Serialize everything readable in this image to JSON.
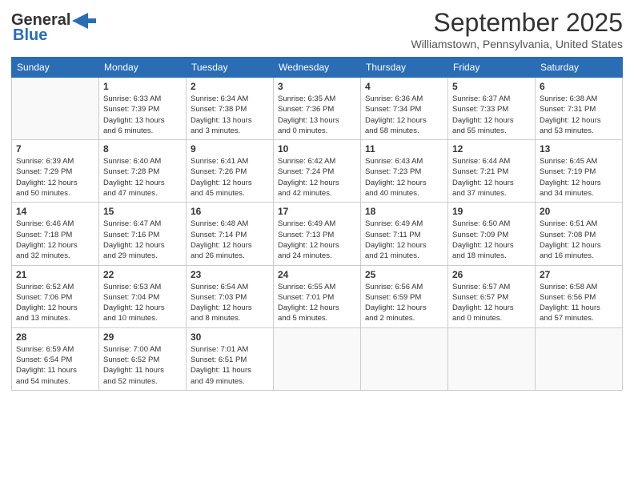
{
  "logo": {
    "line1": "General",
    "line2": "Blue",
    "arrow_color": "#2a6db5"
  },
  "title": "September 2025",
  "location": "Williamstown, Pennsylvania, United States",
  "days_of_week": [
    "Sunday",
    "Monday",
    "Tuesday",
    "Wednesday",
    "Thursday",
    "Friday",
    "Saturday"
  ],
  "weeks": [
    [
      {
        "day": "",
        "info": ""
      },
      {
        "day": "1",
        "info": "Sunrise: 6:33 AM\nSunset: 7:39 PM\nDaylight: 13 hours\nand 6 minutes."
      },
      {
        "day": "2",
        "info": "Sunrise: 6:34 AM\nSunset: 7:38 PM\nDaylight: 13 hours\nand 3 minutes."
      },
      {
        "day": "3",
        "info": "Sunrise: 6:35 AM\nSunset: 7:36 PM\nDaylight: 13 hours\nand 0 minutes."
      },
      {
        "day": "4",
        "info": "Sunrise: 6:36 AM\nSunset: 7:34 PM\nDaylight: 12 hours\nand 58 minutes."
      },
      {
        "day": "5",
        "info": "Sunrise: 6:37 AM\nSunset: 7:33 PM\nDaylight: 12 hours\nand 55 minutes."
      },
      {
        "day": "6",
        "info": "Sunrise: 6:38 AM\nSunset: 7:31 PM\nDaylight: 12 hours\nand 53 minutes."
      }
    ],
    [
      {
        "day": "7",
        "info": "Sunrise: 6:39 AM\nSunset: 7:29 PM\nDaylight: 12 hours\nand 50 minutes."
      },
      {
        "day": "8",
        "info": "Sunrise: 6:40 AM\nSunset: 7:28 PM\nDaylight: 12 hours\nand 47 minutes."
      },
      {
        "day": "9",
        "info": "Sunrise: 6:41 AM\nSunset: 7:26 PM\nDaylight: 12 hours\nand 45 minutes."
      },
      {
        "day": "10",
        "info": "Sunrise: 6:42 AM\nSunset: 7:24 PM\nDaylight: 12 hours\nand 42 minutes."
      },
      {
        "day": "11",
        "info": "Sunrise: 6:43 AM\nSunset: 7:23 PM\nDaylight: 12 hours\nand 40 minutes."
      },
      {
        "day": "12",
        "info": "Sunrise: 6:44 AM\nSunset: 7:21 PM\nDaylight: 12 hours\nand 37 minutes."
      },
      {
        "day": "13",
        "info": "Sunrise: 6:45 AM\nSunset: 7:19 PM\nDaylight: 12 hours\nand 34 minutes."
      }
    ],
    [
      {
        "day": "14",
        "info": "Sunrise: 6:46 AM\nSunset: 7:18 PM\nDaylight: 12 hours\nand 32 minutes."
      },
      {
        "day": "15",
        "info": "Sunrise: 6:47 AM\nSunset: 7:16 PM\nDaylight: 12 hours\nand 29 minutes."
      },
      {
        "day": "16",
        "info": "Sunrise: 6:48 AM\nSunset: 7:14 PM\nDaylight: 12 hours\nand 26 minutes."
      },
      {
        "day": "17",
        "info": "Sunrise: 6:49 AM\nSunset: 7:13 PM\nDaylight: 12 hours\nand 24 minutes."
      },
      {
        "day": "18",
        "info": "Sunrise: 6:49 AM\nSunset: 7:11 PM\nDaylight: 12 hours\nand 21 minutes."
      },
      {
        "day": "19",
        "info": "Sunrise: 6:50 AM\nSunset: 7:09 PM\nDaylight: 12 hours\nand 18 minutes."
      },
      {
        "day": "20",
        "info": "Sunrise: 6:51 AM\nSunset: 7:08 PM\nDaylight: 12 hours\nand 16 minutes."
      }
    ],
    [
      {
        "day": "21",
        "info": "Sunrise: 6:52 AM\nSunset: 7:06 PM\nDaylight: 12 hours\nand 13 minutes."
      },
      {
        "day": "22",
        "info": "Sunrise: 6:53 AM\nSunset: 7:04 PM\nDaylight: 12 hours\nand 10 minutes."
      },
      {
        "day": "23",
        "info": "Sunrise: 6:54 AM\nSunset: 7:03 PM\nDaylight: 12 hours\nand 8 minutes."
      },
      {
        "day": "24",
        "info": "Sunrise: 6:55 AM\nSunset: 7:01 PM\nDaylight: 12 hours\nand 5 minutes."
      },
      {
        "day": "25",
        "info": "Sunrise: 6:56 AM\nSunset: 6:59 PM\nDaylight: 12 hours\nand 2 minutes."
      },
      {
        "day": "26",
        "info": "Sunrise: 6:57 AM\nSunset: 6:57 PM\nDaylight: 12 hours\nand 0 minutes."
      },
      {
        "day": "27",
        "info": "Sunrise: 6:58 AM\nSunset: 6:56 PM\nDaylight: 11 hours\nand 57 minutes."
      }
    ],
    [
      {
        "day": "28",
        "info": "Sunrise: 6:59 AM\nSunset: 6:54 PM\nDaylight: 11 hours\nand 54 minutes."
      },
      {
        "day": "29",
        "info": "Sunrise: 7:00 AM\nSunset: 6:52 PM\nDaylight: 11 hours\nand 52 minutes."
      },
      {
        "day": "30",
        "info": "Sunrise: 7:01 AM\nSunset: 6:51 PM\nDaylight: 11 hours\nand 49 minutes."
      },
      {
        "day": "",
        "info": ""
      },
      {
        "day": "",
        "info": ""
      },
      {
        "day": "",
        "info": ""
      },
      {
        "day": "",
        "info": ""
      }
    ]
  ]
}
